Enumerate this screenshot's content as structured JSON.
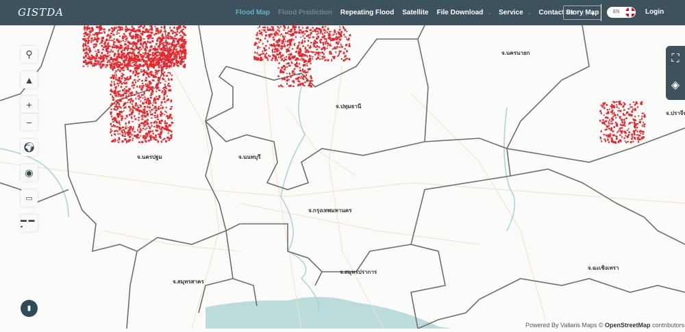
{
  "header": {
    "logo": "GISTDA",
    "nav": [
      {
        "label": "Flood Map",
        "state": "active"
      },
      {
        "label": "Flood Prediction",
        "state": "disabled"
      },
      {
        "label": "Repeating Flood"
      },
      {
        "label": "Satellite"
      },
      {
        "label": "File Download",
        "has_dropdown": true
      },
      {
        "label": "Service",
        "has_dropdown": true
      },
      {
        "label": "Contact us"
      }
    ],
    "home_icon": "home-icon",
    "story_map": "Story Map",
    "language": "EN",
    "login": "Login"
  },
  "map_tools": [
    "search-icon",
    "navigation-arrow-icon",
    "zoom-in-icon",
    "zoom-out-icon",
    "globe-icon",
    "locate-icon",
    "toolbox-icon",
    "measure-icon"
  ],
  "right_panel": [
    "area-search-icon",
    "layers-icon"
  ],
  "provinces": [
    "จ.นครปฐม",
    "จ.นนทบุรี",
    "จ.ปทุมธานี",
    "จ.นครนายก",
    "จ.ปราจีน",
    "จ.กรุงเทพมหานคร",
    "จ.สมุทรสาคร",
    "จ.สมุทรปราการ",
    "จ.ฉะเชิงเทรา"
  ],
  "colors": {
    "header": "#3d525c",
    "flood": "#e8262b",
    "accent": "#5fb6c8",
    "sea": "#bcdcdb"
  },
  "attribution": {
    "prefix": "Powered By Vallaris Maps ©",
    "osm": "OpenStreetMap",
    "suffix": "contributors"
  }
}
